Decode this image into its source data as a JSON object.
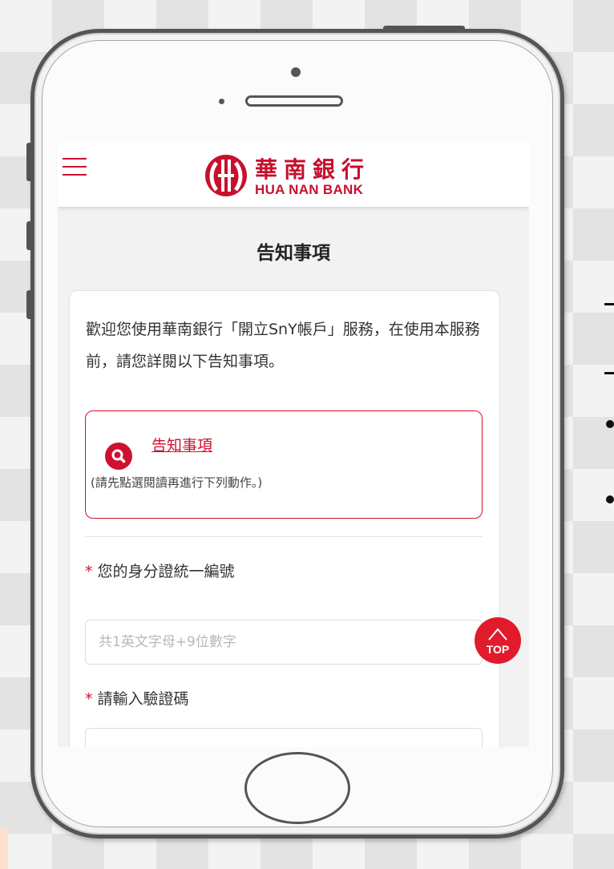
{
  "header": {
    "logo_cn": "華南銀行",
    "logo_en": "HUA NAN BANK"
  },
  "page": {
    "title": "告知事項",
    "intro": "歡迎您使用華南銀行「開立SnY帳戶」服務，在使用本服務前，請您詳閱以下告知事項。"
  },
  "notice": {
    "link_label": "告知事項",
    "hint": "(請先點選閱讀再進行下列動作。)"
  },
  "form": {
    "required_mark": "*",
    "id_label": "您的身分證統一編號",
    "id_placeholder": "共1英文字母+9位數字",
    "captcha_label": "請輸入驗證碼",
    "captcha_placeholder": ""
  },
  "top_button": {
    "label": "TOP"
  },
  "colors": {
    "brand_red": "#c8102e",
    "button_red": "#e11b2c"
  },
  "icons": [
    "menu-icon",
    "bank-logo-icon",
    "search-icon",
    "chevron-up-icon"
  ]
}
